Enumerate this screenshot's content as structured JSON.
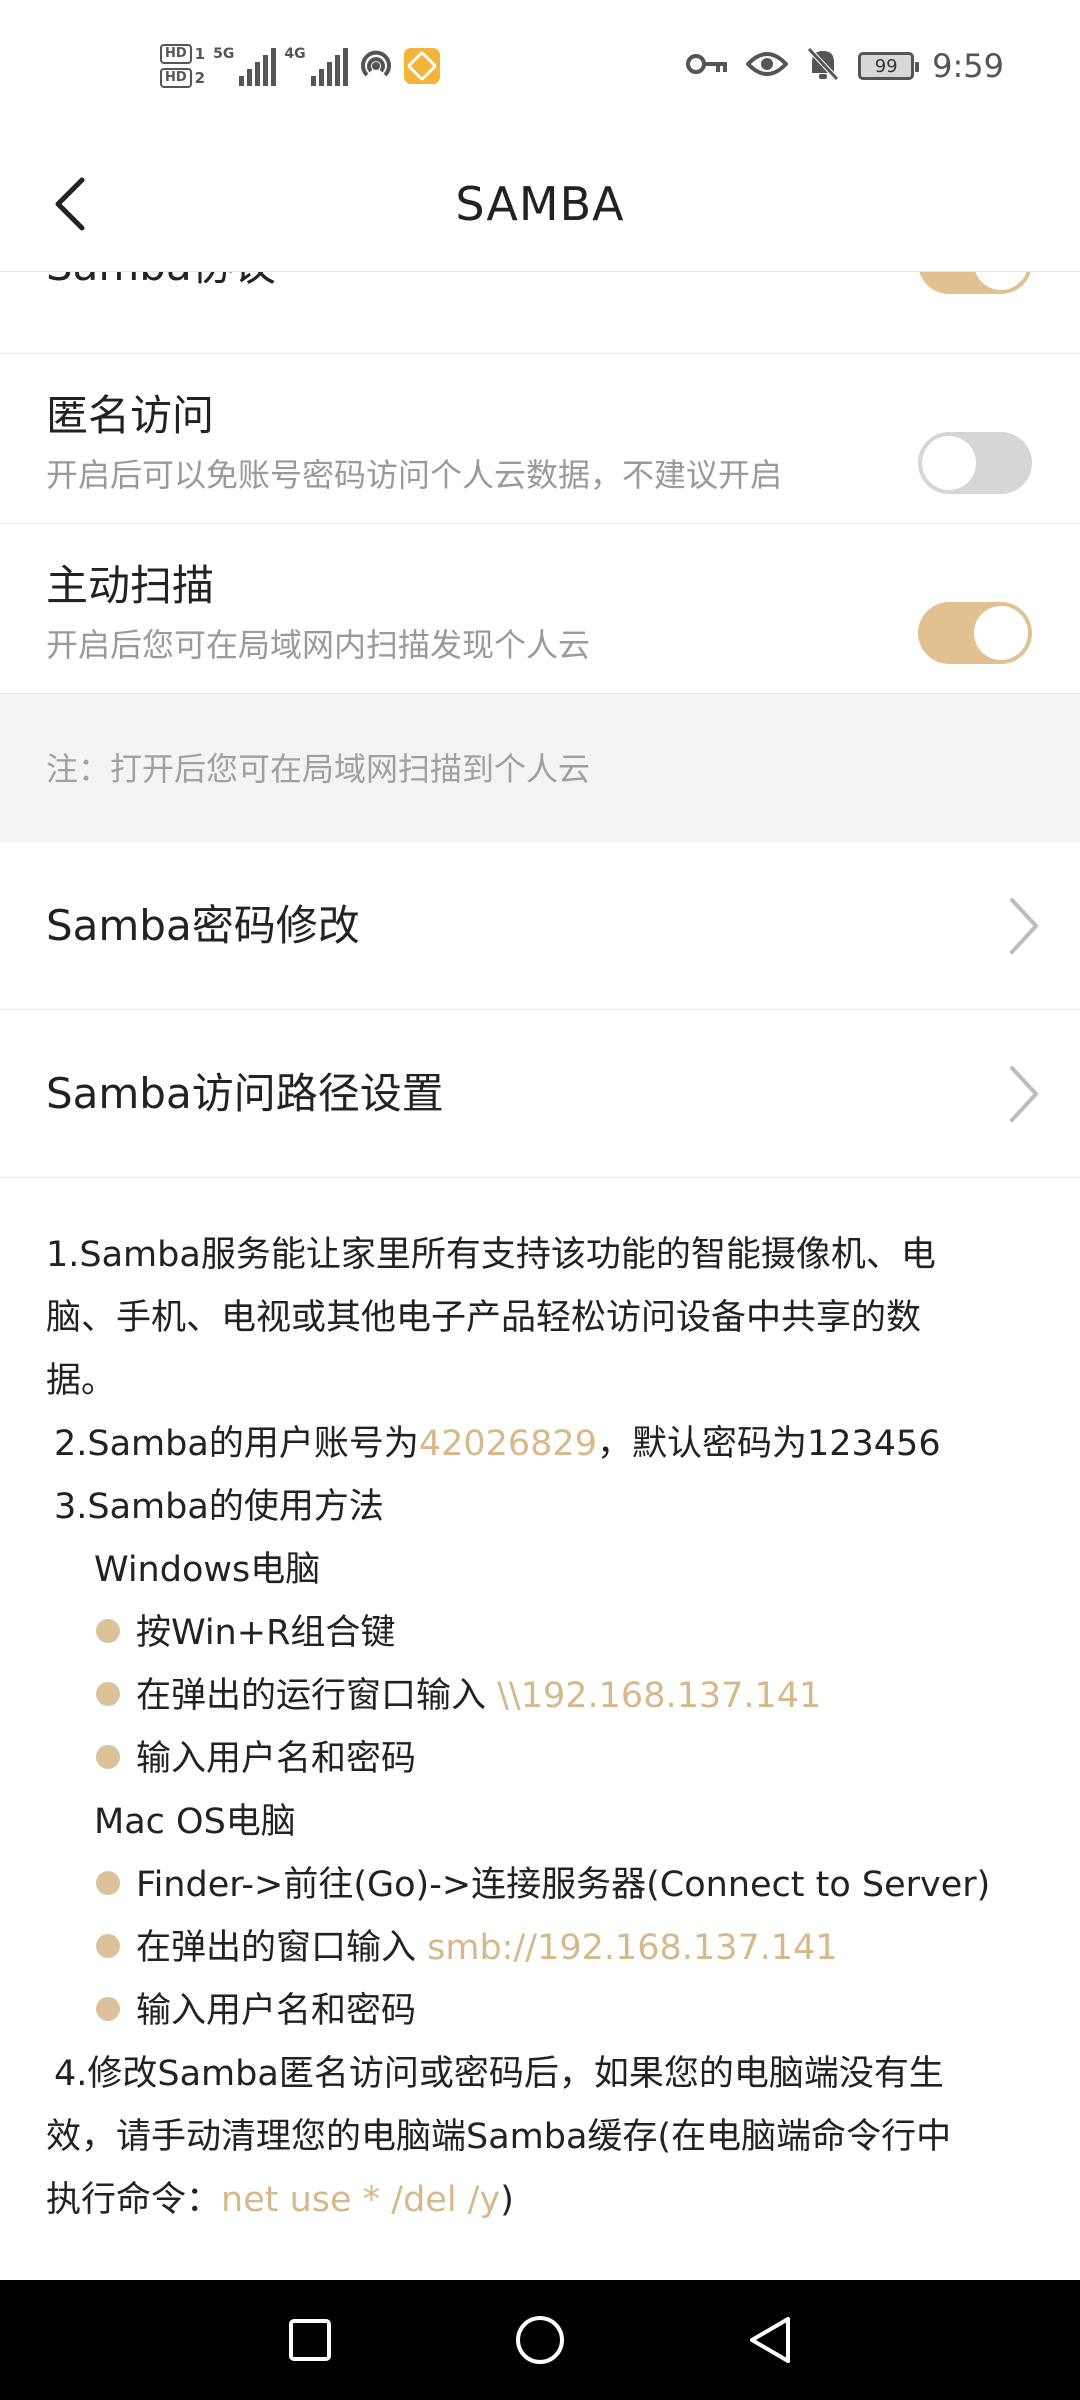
{
  "status_bar": {
    "sim1_label": "HD",
    "sim1_index": "1",
    "sim2_label": "HD",
    "sim2_index": "2",
    "net1": "5G",
    "net2": "4G",
    "battery": "99",
    "time": "9:59",
    "icons": [
      "signal-icon",
      "signal-icon",
      "hotspot-icon",
      "app-notification-icon",
      "key-icon",
      "eye-icon",
      "mute-bell-icon",
      "battery-icon"
    ]
  },
  "header": {
    "title": "SAMBA",
    "back_icon": "chevron-left-icon"
  },
  "settings": {
    "samba_protocol": {
      "title": "Samba协议",
      "enabled": true
    },
    "anonymous": {
      "title": "匿名访问",
      "subtitle": "开启后可以免账号密码访问个人云数据，不建议开启",
      "enabled": false
    },
    "active_scan": {
      "title": "主动扫描",
      "subtitle": "开启后您可在局域网内扫描发现个人云",
      "enabled": true
    }
  },
  "note": "注：打开后您可在局域网扫描到个人云",
  "links": [
    {
      "label": "Samba密码修改"
    },
    {
      "label": "Samba访问路径设置"
    }
  ],
  "info": {
    "p1_l1": "1.Samba服务能让家里所有支持该功能的智能摄像机、电",
    "p1_l2": "脑、手机、电视或其他电子产品轻松访问设备中共享的数",
    "p1_l3": "据。",
    "p2_prefix": "2.Samba的用户账号为",
    "account": "42026829",
    "p2_suffix": "，默认密码为123456",
    "p3": "3.Samba的使用方法",
    "windows_title": "Windows电脑",
    "win_step1": "按Win+R组合键",
    "win_step2_prefix": "在弹出的运行窗口输入 ",
    "win_path": "\\\\192.168.137.141",
    "win_step3": "输入用户名和密码",
    "mac_title": "Mac OS电脑",
    "mac_step1": "Finder->前往(Go)->连接服务器(Connect to Server)",
    "mac_step2_prefix": "在弹出的窗口输入 ",
    "mac_path": "smb://192.168.137.141",
    "mac_step3": "输入用户名和密码",
    "p4_l1": "4.修改Samba匿名访问或密码后，如果您的电脑端没有生",
    "p4_l2": "效，请手动清理您的电脑端Samba缓存(在电脑端命令行中",
    "p4_l3_prefix": "执行命令：",
    "command": "net use * /del /y",
    "p4_l3_suffix": ")"
  },
  "colors": {
    "accent": "#e0c18f",
    "highlight_text": "#d8b88a",
    "toggle_off": "#d6d6d6",
    "note_bg": "#f3f4f6"
  }
}
